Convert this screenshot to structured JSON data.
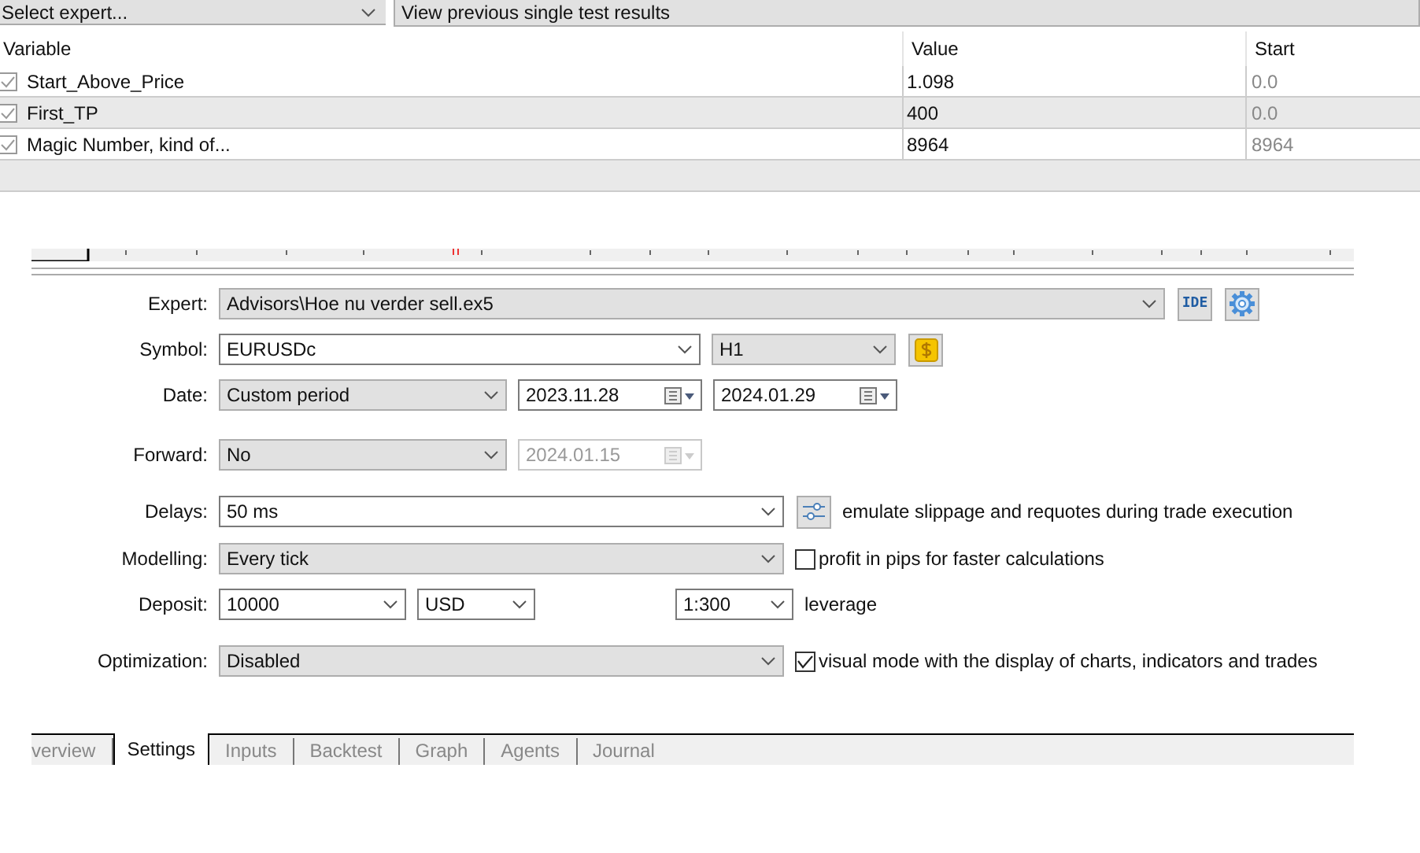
{
  "top_bar": {
    "expert_select": "Select expert...",
    "results_button": "View previous single test results"
  },
  "table": {
    "columns": [
      "Variable",
      "Value",
      "Start"
    ],
    "rows": [
      {
        "checked": true,
        "variable": "Start_Above_Price",
        "value": "1.098",
        "start": "0.0"
      },
      {
        "checked": true,
        "variable": "First_TP",
        "value": "400",
        "start": "0.0"
      },
      {
        "checked": true,
        "variable": "Magic Number, kind of...",
        "value": "8964",
        "start": "8964"
      }
    ]
  },
  "settings": [
    {
      "label": "Expert:",
      "controls": [
        {
          "kind": "combo",
          "value": "Advisors\\Hoe nu verder sell.ex5",
          "editable": false
        },
        {
          "kind": "ide",
          "text": "IDE"
        },
        {
          "kind": "gear"
        }
      ]
    },
    {
      "label": "Symbol:",
      "controls": [
        {
          "kind": "combo",
          "value": "EURUSDc",
          "editable": true
        },
        {
          "kind": "combo",
          "value": "H1",
          "editable": false
        },
        {
          "kind": "dollar"
        }
      ]
    },
    {
      "label": "Date:",
      "controls": [
        {
          "kind": "combo",
          "value": "Custom period",
          "editable": false
        },
        {
          "kind": "date",
          "value": "2023.11.28",
          "disabled": false
        },
        {
          "kind": "date",
          "value": "2024.01.29",
          "disabled": false
        }
      ]
    },
    {
      "label": "Forward:",
      "controls": [
        {
          "kind": "combo",
          "value": "No",
          "editable": false
        },
        {
          "kind": "date",
          "value": "2024.01.15",
          "disabled": true
        }
      ]
    },
    {
      "label": "Delays:",
      "controls": [
        {
          "kind": "combo",
          "value": "50 ms",
          "editable": true
        },
        {
          "kind": "sliders"
        },
        {
          "kind": "text",
          "text": "emulate slippage and requotes during trade execution"
        }
      ]
    },
    {
      "label": "Modelling:",
      "controls": [
        {
          "kind": "combo",
          "value": "Every tick",
          "editable": false
        },
        {
          "kind": "check",
          "text": "profit in pips for faster calculations",
          "checked": false
        }
      ]
    },
    {
      "label": "Deposit:",
      "controls": [
        {
          "kind": "combo",
          "value": "10000",
          "editable": true
        },
        {
          "kind": "combo",
          "value": "USD",
          "editable": true
        },
        {
          "kind": "combo",
          "value": "1:300",
          "editable": true
        },
        {
          "kind": "text",
          "text": "leverage"
        }
      ]
    },
    {
      "label": "Optimization:",
      "controls": [
        {
          "kind": "combo",
          "value": "Disabled",
          "editable": false
        },
        {
          "kind": "check",
          "text": "visual mode with the display of charts, indicators and trades",
          "checked": true
        }
      ]
    }
  ],
  "tabs": [
    {
      "label": "verview",
      "selected": false
    },
    {
      "label": "Settings",
      "selected": true
    },
    {
      "label": "Inputs",
      "selected": false
    },
    {
      "label": "Backtest",
      "selected": false
    },
    {
      "label": "Graph",
      "selected": false
    },
    {
      "label": "Agents",
      "selected": false
    },
    {
      "label": "Journal",
      "selected": false
    }
  ]
}
